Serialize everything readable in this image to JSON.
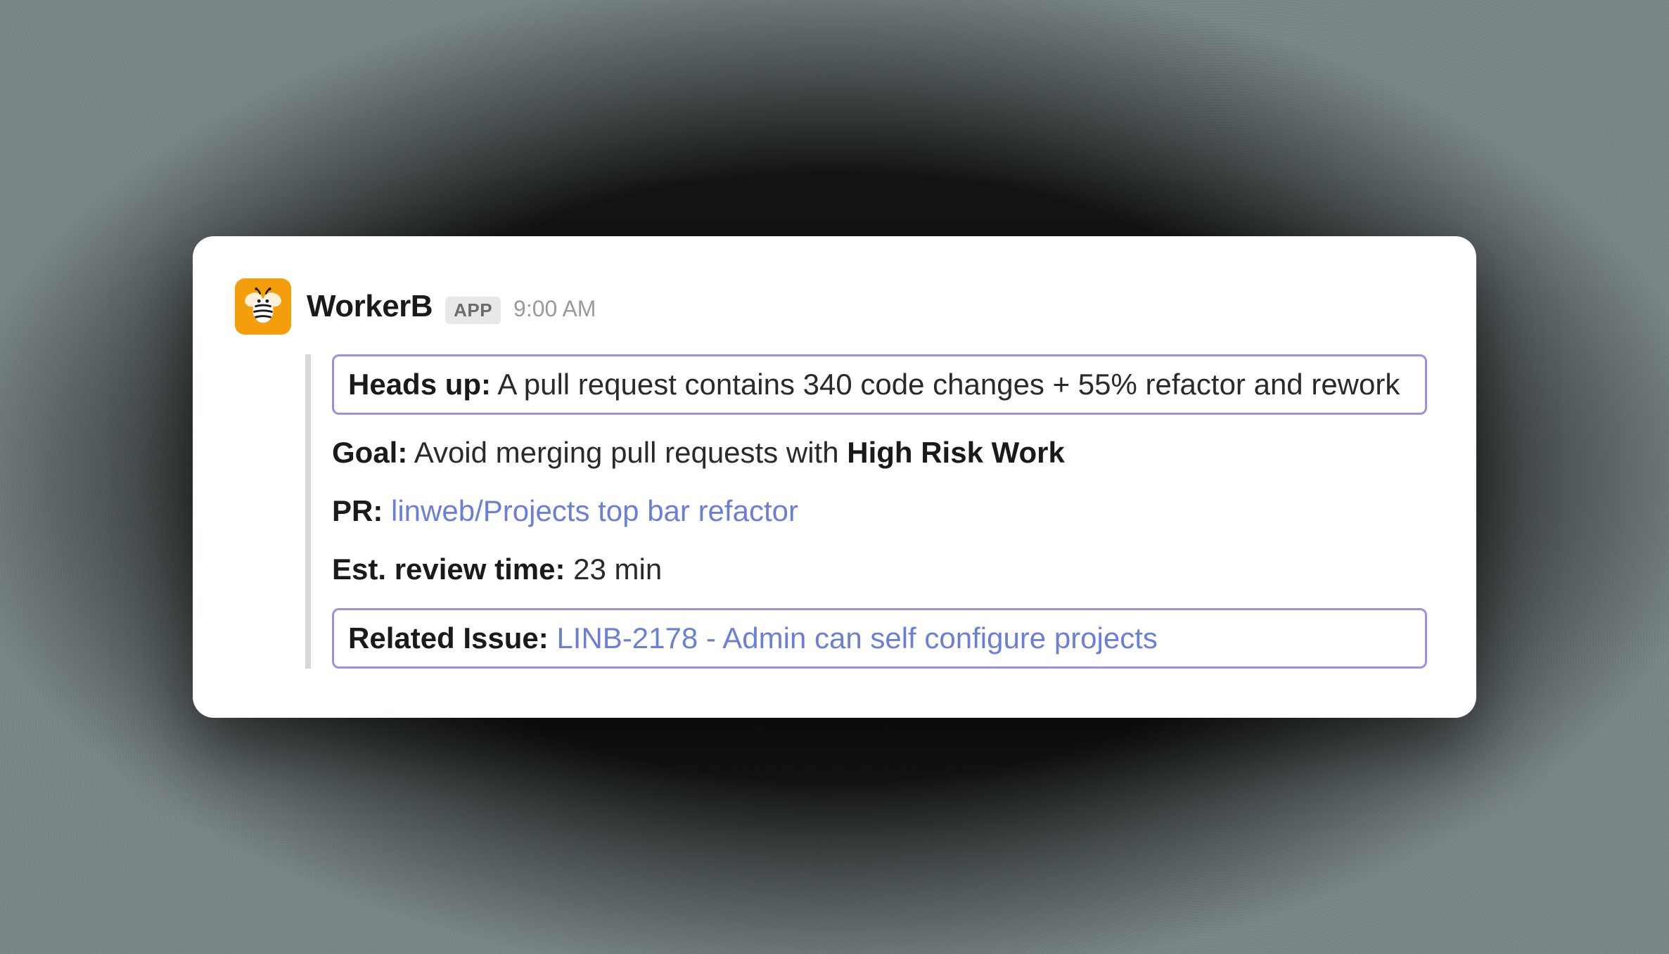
{
  "header": {
    "app_name": "WorkerB",
    "badge": "APP",
    "timestamp": "9:00 AM"
  },
  "message": {
    "heads_up_label": "Heads up:",
    "heads_up_text": " A pull request contains 340 code changes + 55% refactor and rework",
    "goal_label": "Goal:",
    "goal_text": " Avoid merging pull requests with ",
    "goal_emphasis": "High Risk Work",
    "pr_label": "PR:",
    "pr_link": "linweb/Projects top bar refactor",
    "review_label": "Est. review time:",
    "review_value": " 23 min",
    "issue_label": "Related Issue:",
    "issue_link": "LINB-2178  - Admin can self configure projects"
  }
}
